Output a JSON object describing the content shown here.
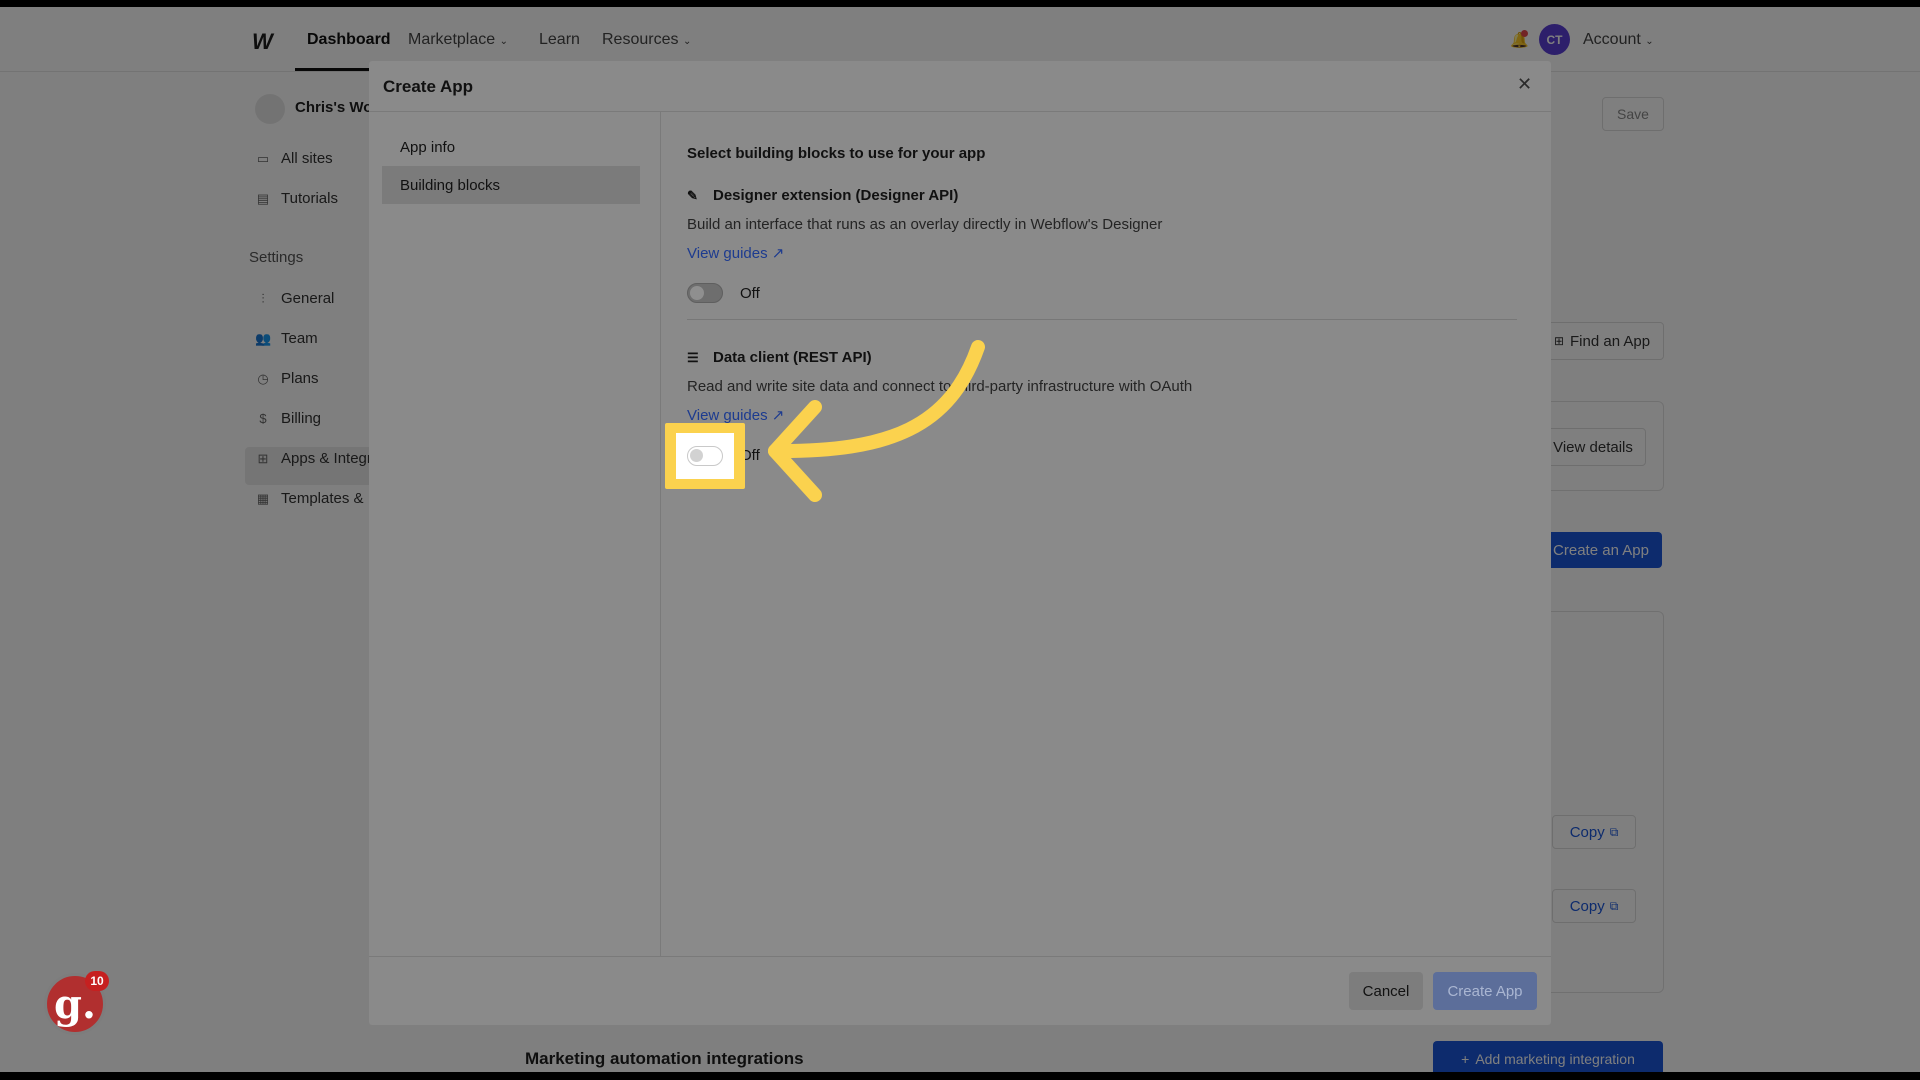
{
  "nav": {
    "items": [
      "Dashboard",
      "Marketplace",
      "Learn",
      "Resources"
    ],
    "account_label": "Account",
    "avatar_initials": "CT"
  },
  "sidebar": {
    "workspace_name": "Chris's Workspace",
    "items": [
      {
        "label": "All sites",
        "icon": "folder-icon"
      },
      {
        "label": "Tutorials",
        "icon": "tutorials-icon"
      }
    ],
    "settings_heading": "Settings",
    "settings_items": [
      {
        "label": "General",
        "icon": "sliders-icon"
      },
      {
        "label": "Team",
        "icon": "team-icon"
      },
      {
        "label": "Plans",
        "icon": "plans-icon"
      },
      {
        "label": "Billing",
        "icon": "dollar-icon"
      },
      {
        "label": "Apps & Integrations",
        "icon": "apps-icon"
      },
      {
        "label": "Templates & ...",
        "icon": "templates-icon"
      }
    ]
  },
  "background": {
    "save_label": "Save",
    "find_app_label": "Find an App",
    "view_details_label": "View details",
    "create_an_app_label": "Create an App",
    "copy_label": "Copy",
    "marketing_heading": "Marketing automation integrations",
    "add_marketing_label": "Add marketing integration"
  },
  "modal": {
    "title": "Create App",
    "nav": [
      "App info",
      "Building blocks"
    ],
    "active_nav": "Building blocks",
    "section_title": "Select building blocks to use for your app",
    "blocks": [
      {
        "title": "Designer extension (Designer API)",
        "icon": "brush-icon",
        "description": "Build an interface that runs as an overlay directly in Webflow's Designer",
        "link": "View guides ↗",
        "toggle_state": "Off"
      },
      {
        "title": "Data client (REST API)",
        "icon": "database-icon",
        "description": "Read and write site data and connect to third-party infrastructure with OAuth",
        "link": "View guides ↗",
        "toggle_state": "Off"
      }
    ],
    "cancel_label": "Cancel",
    "create_label": "Create App"
  },
  "annotation": {
    "highlight_color": "#fbd24e"
  },
  "guidde_badge": {
    "letter": "g.",
    "count": "10"
  }
}
